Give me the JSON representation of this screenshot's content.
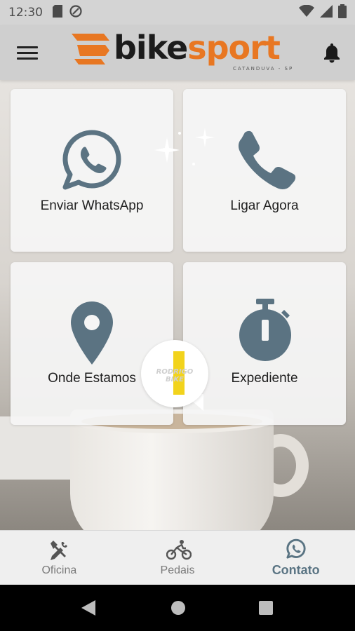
{
  "status_bar": {
    "time": "12:30",
    "icons": [
      "sd-card-icon",
      "vpn-icon",
      "wifi-icon",
      "signal-icon",
      "battery-icon"
    ]
  },
  "app_bar": {
    "logo_text_1": "bike",
    "logo_text_2": "sport",
    "logo_subtitle": "CATANDUVA - SP",
    "menu_icon": "hamburger-menu-icon",
    "notification_icon": "bell-icon"
  },
  "cards": [
    {
      "label": "Enviar WhatsApp",
      "icon": "whatsapp-icon"
    },
    {
      "label": "Ligar Agora",
      "icon": "phone-icon"
    },
    {
      "label": "Onde Estamos",
      "icon": "location-pin-icon"
    },
    {
      "label": "Expediente",
      "icon": "stopwatch-icon"
    }
  ],
  "badge": {
    "text": "RODRIGO BIKE"
  },
  "bottom_nav": {
    "items": [
      {
        "label": "Oficina",
        "icon": "tools-icon",
        "active": false
      },
      {
        "label": "Pedais",
        "icon": "cyclist-icon",
        "active": false
      },
      {
        "label": "Contato",
        "icon": "whatsapp-icon",
        "active": true
      }
    ]
  },
  "colors": {
    "accent": "#5a7483",
    "brand_orange": "#e87722",
    "icon": "#5b7382"
  }
}
